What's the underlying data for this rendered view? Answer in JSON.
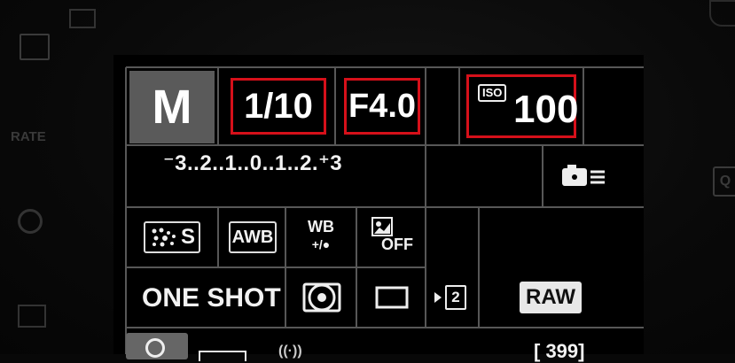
{
  "side": {
    "rate_label": "RATE"
  },
  "mode": "M",
  "shutter": "1/10",
  "aperture": "F4.0",
  "iso": {
    "label": "ISO",
    "value": "100"
  },
  "exposure_scale": "⁻3..2..1..0..1..2.⁺3",
  "row3": {
    "picture_style": "S",
    "white_balance": "AWB",
    "wb_shift_top": "WB",
    "wb_shift_bottom": "+/●",
    "alo": "OFF"
  },
  "row4": {
    "af_mode": "ONE SHOT",
    "drive": "2",
    "quality": "RAW"
  },
  "bottom": {
    "shots_partial": "[  399]"
  }
}
